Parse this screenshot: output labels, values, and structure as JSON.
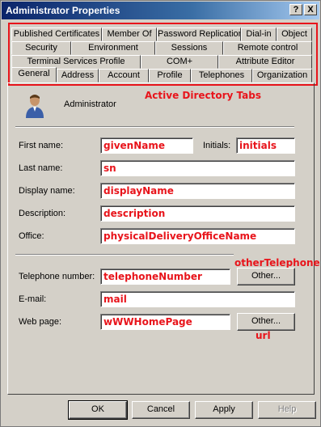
{
  "window": {
    "title": "Administrator Properties",
    "help_glyph": "?",
    "close_glyph": "X"
  },
  "tabs": {
    "row1": [
      "Published Certificates",
      "Member Of",
      "Password Replication",
      "Dial-in",
      "Object"
    ],
    "row2": [
      "Security",
      "Environment",
      "Sessions",
      "Remote control"
    ],
    "row3": [
      "Terminal Services Profile",
      "COM+",
      "Attribute Editor"
    ],
    "row4": [
      "General",
      "Address",
      "Account",
      "Profile",
      "Telephones",
      "Organization"
    ],
    "active": "General"
  },
  "annotations": {
    "tabs_label": "Active Directory Tabs",
    "other_telephone": "otherTelephone",
    "url": "url",
    "color": "#e8141b"
  },
  "general": {
    "user_name": "Administrator",
    "fields": {
      "first_name": {
        "label": "First name:",
        "value": "givenName"
      },
      "initials": {
        "label": "Initials:",
        "value": "initials"
      },
      "last_name": {
        "label": "Last name:",
        "value": "sn"
      },
      "display_name": {
        "label": "Display name:",
        "value": "displayName"
      },
      "description": {
        "label": "Description:",
        "value": "description"
      },
      "office": {
        "label": "Office:",
        "value": "physicalDeliveryOfficeName"
      },
      "telephone": {
        "label": "Telephone number:",
        "value": "telephoneNumber"
      },
      "email": {
        "label": "E-mail:",
        "value": "mail"
      },
      "web_page": {
        "label": "Web page:",
        "value": "wWWHomePage"
      }
    },
    "other_label": "Other..."
  },
  "footer": {
    "ok": "OK",
    "cancel": "Cancel",
    "apply": "Apply",
    "help": "Help"
  }
}
